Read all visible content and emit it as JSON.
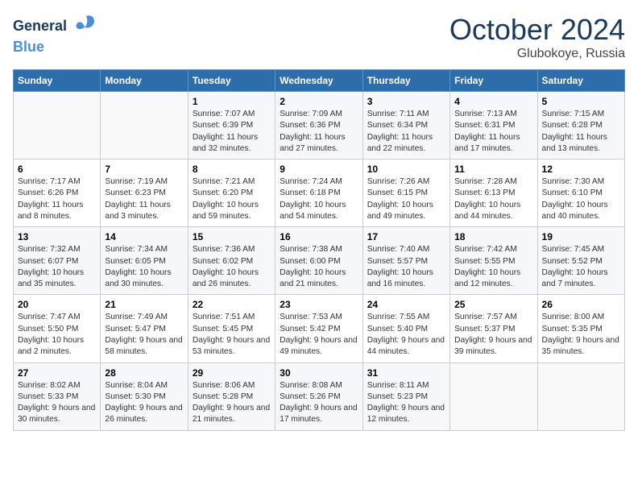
{
  "header": {
    "logo_line1": "General",
    "logo_line2": "Blue",
    "month": "October 2024",
    "location": "Glubokoye, Russia"
  },
  "days_of_week": [
    "Sunday",
    "Monday",
    "Tuesday",
    "Wednesday",
    "Thursday",
    "Friday",
    "Saturday"
  ],
  "weeks": [
    [
      {
        "num": "",
        "info": ""
      },
      {
        "num": "",
        "info": ""
      },
      {
        "num": "1",
        "info": "Sunrise: 7:07 AM\nSunset: 6:39 PM\nDaylight: 11 hours and 32 minutes."
      },
      {
        "num": "2",
        "info": "Sunrise: 7:09 AM\nSunset: 6:36 PM\nDaylight: 11 hours and 27 minutes."
      },
      {
        "num": "3",
        "info": "Sunrise: 7:11 AM\nSunset: 6:34 PM\nDaylight: 11 hours and 22 minutes."
      },
      {
        "num": "4",
        "info": "Sunrise: 7:13 AM\nSunset: 6:31 PM\nDaylight: 11 hours and 17 minutes."
      },
      {
        "num": "5",
        "info": "Sunrise: 7:15 AM\nSunset: 6:28 PM\nDaylight: 11 hours and 13 minutes."
      }
    ],
    [
      {
        "num": "6",
        "info": "Sunrise: 7:17 AM\nSunset: 6:26 PM\nDaylight: 11 hours and 8 minutes."
      },
      {
        "num": "7",
        "info": "Sunrise: 7:19 AM\nSunset: 6:23 PM\nDaylight: 11 hours and 3 minutes."
      },
      {
        "num": "8",
        "info": "Sunrise: 7:21 AM\nSunset: 6:20 PM\nDaylight: 10 hours and 59 minutes."
      },
      {
        "num": "9",
        "info": "Sunrise: 7:24 AM\nSunset: 6:18 PM\nDaylight: 10 hours and 54 minutes."
      },
      {
        "num": "10",
        "info": "Sunrise: 7:26 AM\nSunset: 6:15 PM\nDaylight: 10 hours and 49 minutes."
      },
      {
        "num": "11",
        "info": "Sunrise: 7:28 AM\nSunset: 6:13 PM\nDaylight: 10 hours and 44 minutes."
      },
      {
        "num": "12",
        "info": "Sunrise: 7:30 AM\nSunset: 6:10 PM\nDaylight: 10 hours and 40 minutes."
      }
    ],
    [
      {
        "num": "13",
        "info": "Sunrise: 7:32 AM\nSunset: 6:07 PM\nDaylight: 10 hours and 35 minutes."
      },
      {
        "num": "14",
        "info": "Sunrise: 7:34 AM\nSunset: 6:05 PM\nDaylight: 10 hours and 30 minutes."
      },
      {
        "num": "15",
        "info": "Sunrise: 7:36 AM\nSunset: 6:02 PM\nDaylight: 10 hours and 26 minutes."
      },
      {
        "num": "16",
        "info": "Sunrise: 7:38 AM\nSunset: 6:00 PM\nDaylight: 10 hours and 21 minutes."
      },
      {
        "num": "17",
        "info": "Sunrise: 7:40 AM\nSunset: 5:57 PM\nDaylight: 10 hours and 16 minutes."
      },
      {
        "num": "18",
        "info": "Sunrise: 7:42 AM\nSunset: 5:55 PM\nDaylight: 10 hours and 12 minutes."
      },
      {
        "num": "19",
        "info": "Sunrise: 7:45 AM\nSunset: 5:52 PM\nDaylight: 10 hours and 7 minutes."
      }
    ],
    [
      {
        "num": "20",
        "info": "Sunrise: 7:47 AM\nSunset: 5:50 PM\nDaylight: 10 hours and 2 minutes."
      },
      {
        "num": "21",
        "info": "Sunrise: 7:49 AM\nSunset: 5:47 PM\nDaylight: 9 hours and 58 minutes."
      },
      {
        "num": "22",
        "info": "Sunrise: 7:51 AM\nSunset: 5:45 PM\nDaylight: 9 hours and 53 minutes."
      },
      {
        "num": "23",
        "info": "Sunrise: 7:53 AM\nSunset: 5:42 PM\nDaylight: 9 hours and 49 minutes."
      },
      {
        "num": "24",
        "info": "Sunrise: 7:55 AM\nSunset: 5:40 PM\nDaylight: 9 hours and 44 minutes."
      },
      {
        "num": "25",
        "info": "Sunrise: 7:57 AM\nSunset: 5:37 PM\nDaylight: 9 hours and 39 minutes."
      },
      {
        "num": "26",
        "info": "Sunrise: 8:00 AM\nSunset: 5:35 PM\nDaylight: 9 hours and 35 minutes."
      }
    ],
    [
      {
        "num": "27",
        "info": "Sunrise: 8:02 AM\nSunset: 5:33 PM\nDaylight: 9 hours and 30 minutes."
      },
      {
        "num": "28",
        "info": "Sunrise: 8:04 AM\nSunset: 5:30 PM\nDaylight: 9 hours and 26 minutes."
      },
      {
        "num": "29",
        "info": "Sunrise: 8:06 AM\nSunset: 5:28 PM\nDaylight: 9 hours and 21 minutes."
      },
      {
        "num": "30",
        "info": "Sunrise: 8:08 AM\nSunset: 5:26 PM\nDaylight: 9 hours and 17 minutes."
      },
      {
        "num": "31",
        "info": "Sunrise: 8:11 AM\nSunset: 5:23 PM\nDaylight: 9 hours and 12 minutes."
      },
      {
        "num": "",
        "info": ""
      },
      {
        "num": "",
        "info": ""
      }
    ]
  ]
}
